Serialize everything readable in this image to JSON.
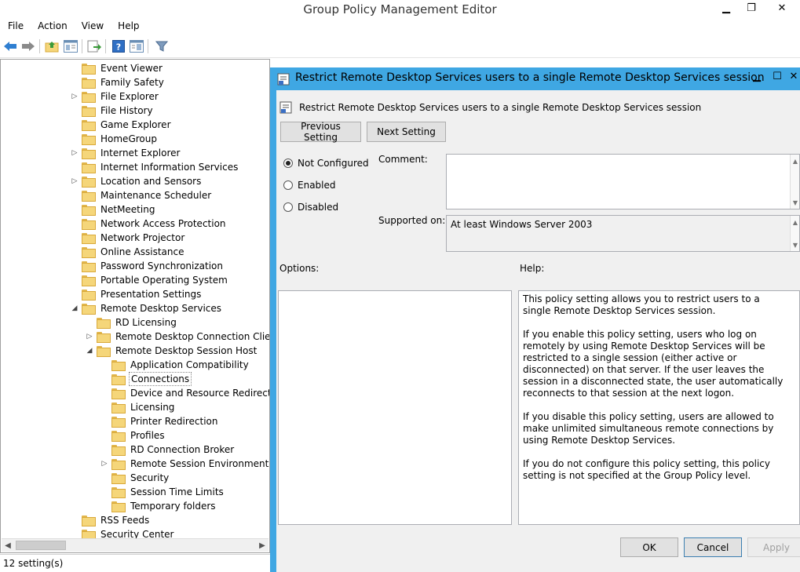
{
  "window": {
    "title": "Group Policy Management Editor"
  },
  "menu": [
    "File",
    "Action",
    "View",
    "Help"
  ],
  "tree": {
    "items": [
      {
        "label": "Event Viewer",
        "indent": 0,
        "expander": ""
      },
      {
        "label": "Family Safety",
        "indent": 0,
        "expander": ""
      },
      {
        "label": "File Explorer",
        "indent": 0,
        "expander": "▷"
      },
      {
        "label": "File History",
        "indent": 0,
        "expander": ""
      },
      {
        "label": "Game Explorer",
        "indent": 0,
        "expander": ""
      },
      {
        "label": "HomeGroup",
        "indent": 0,
        "expander": ""
      },
      {
        "label": "Internet Explorer",
        "indent": 0,
        "expander": "▷"
      },
      {
        "label": "Internet Information Services",
        "indent": 0,
        "expander": ""
      },
      {
        "label": "Location and Sensors",
        "indent": 0,
        "expander": "▷"
      },
      {
        "label": "Maintenance Scheduler",
        "indent": 0,
        "expander": ""
      },
      {
        "label": "NetMeeting",
        "indent": 0,
        "expander": ""
      },
      {
        "label": "Network Access Protection",
        "indent": 0,
        "expander": ""
      },
      {
        "label": "Network Projector",
        "indent": 0,
        "expander": ""
      },
      {
        "label": "Online Assistance",
        "indent": 0,
        "expander": ""
      },
      {
        "label": "Password Synchronization",
        "indent": 0,
        "expander": ""
      },
      {
        "label": "Portable Operating System",
        "indent": 0,
        "expander": ""
      },
      {
        "label": "Presentation Settings",
        "indent": 0,
        "expander": ""
      },
      {
        "label": "Remote Desktop Services",
        "indent": 0,
        "expander": "◢"
      },
      {
        "label": "RD Licensing",
        "indent": 1,
        "expander": ""
      },
      {
        "label": "Remote Desktop Connection Client",
        "indent": 1,
        "expander": "▷"
      },
      {
        "label": "Remote Desktop Session Host",
        "indent": 1,
        "expander": "◢"
      },
      {
        "label": "Application Compatibility",
        "indent": 2,
        "expander": ""
      },
      {
        "label": "Connections",
        "indent": 2,
        "expander": "",
        "selected": true
      },
      {
        "label": "Device and Resource Redirection",
        "indent": 2,
        "expander": ""
      },
      {
        "label": "Licensing",
        "indent": 2,
        "expander": ""
      },
      {
        "label": "Printer Redirection",
        "indent": 2,
        "expander": ""
      },
      {
        "label": "Profiles",
        "indent": 2,
        "expander": ""
      },
      {
        "label": "RD Connection Broker",
        "indent": 2,
        "expander": ""
      },
      {
        "label": "Remote Session Environment",
        "indent": 2,
        "expander": "▷"
      },
      {
        "label": "Security",
        "indent": 2,
        "expander": ""
      },
      {
        "label": "Session Time Limits",
        "indent": 2,
        "expander": ""
      },
      {
        "label": "Temporary folders",
        "indent": 2,
        "expander": ""
      },
      {
        "label": "RSS Feeds",
        "indent": 0,
        "expander": ""
      },
      {
        "label": "Security Center",
        "indent": 0,
        "expander": ""
      }
    ]
  },
  "status": {
    "text": "12 setting(s)"
  },
  "dialog": {
    "title": "Restrict Remote Desktop Services users to a single Remote Desktop Services session",
    "subtitle": "Restrict Remote Desktop Services users to a single Remote Desktop Services session",
    "previous_label": "Previous Setting",
    "next_label": "Next Setting",
    "radios": [
      {
        "label": "Not Configured",
        "checked": true
      },
      {
        "label": "Enabled",
        "checked": false
      },
      {
        "label": "Disabled",
        "checked": false
      }
    ],
    "comment_label": "Comment:",
    "comment_value": "",
    "supported_label": "Supported on:",
    "supported_value": "At least Windows Server 2003",
    "options_label": "Options:",
    "help_label": "Help:",
    "help_paragraphs": [
      "This policy setting allows you to restrict users to a single Remote Desktop Services session.",
      "If you enable this policy setting, users who log on remotely by using Remote Desktop Services will be restricted to a single session (either active or disconnected) on that server. If the user leaves the session in a disconnected state, the user automatically reconnects to that session at the next logon.",
      "If you disable this policy setting, users are allowed to make unlimited simultaneous remote connections by using Remote Desktop Services.",
      "If you do not configure this policy setting,  this policy setting is not specified at the Group Policy level."
    ],
    "ok_label": "OK",
    "cancel_label": "Cancel",
    "apply_label": "Apply"
  }
}
